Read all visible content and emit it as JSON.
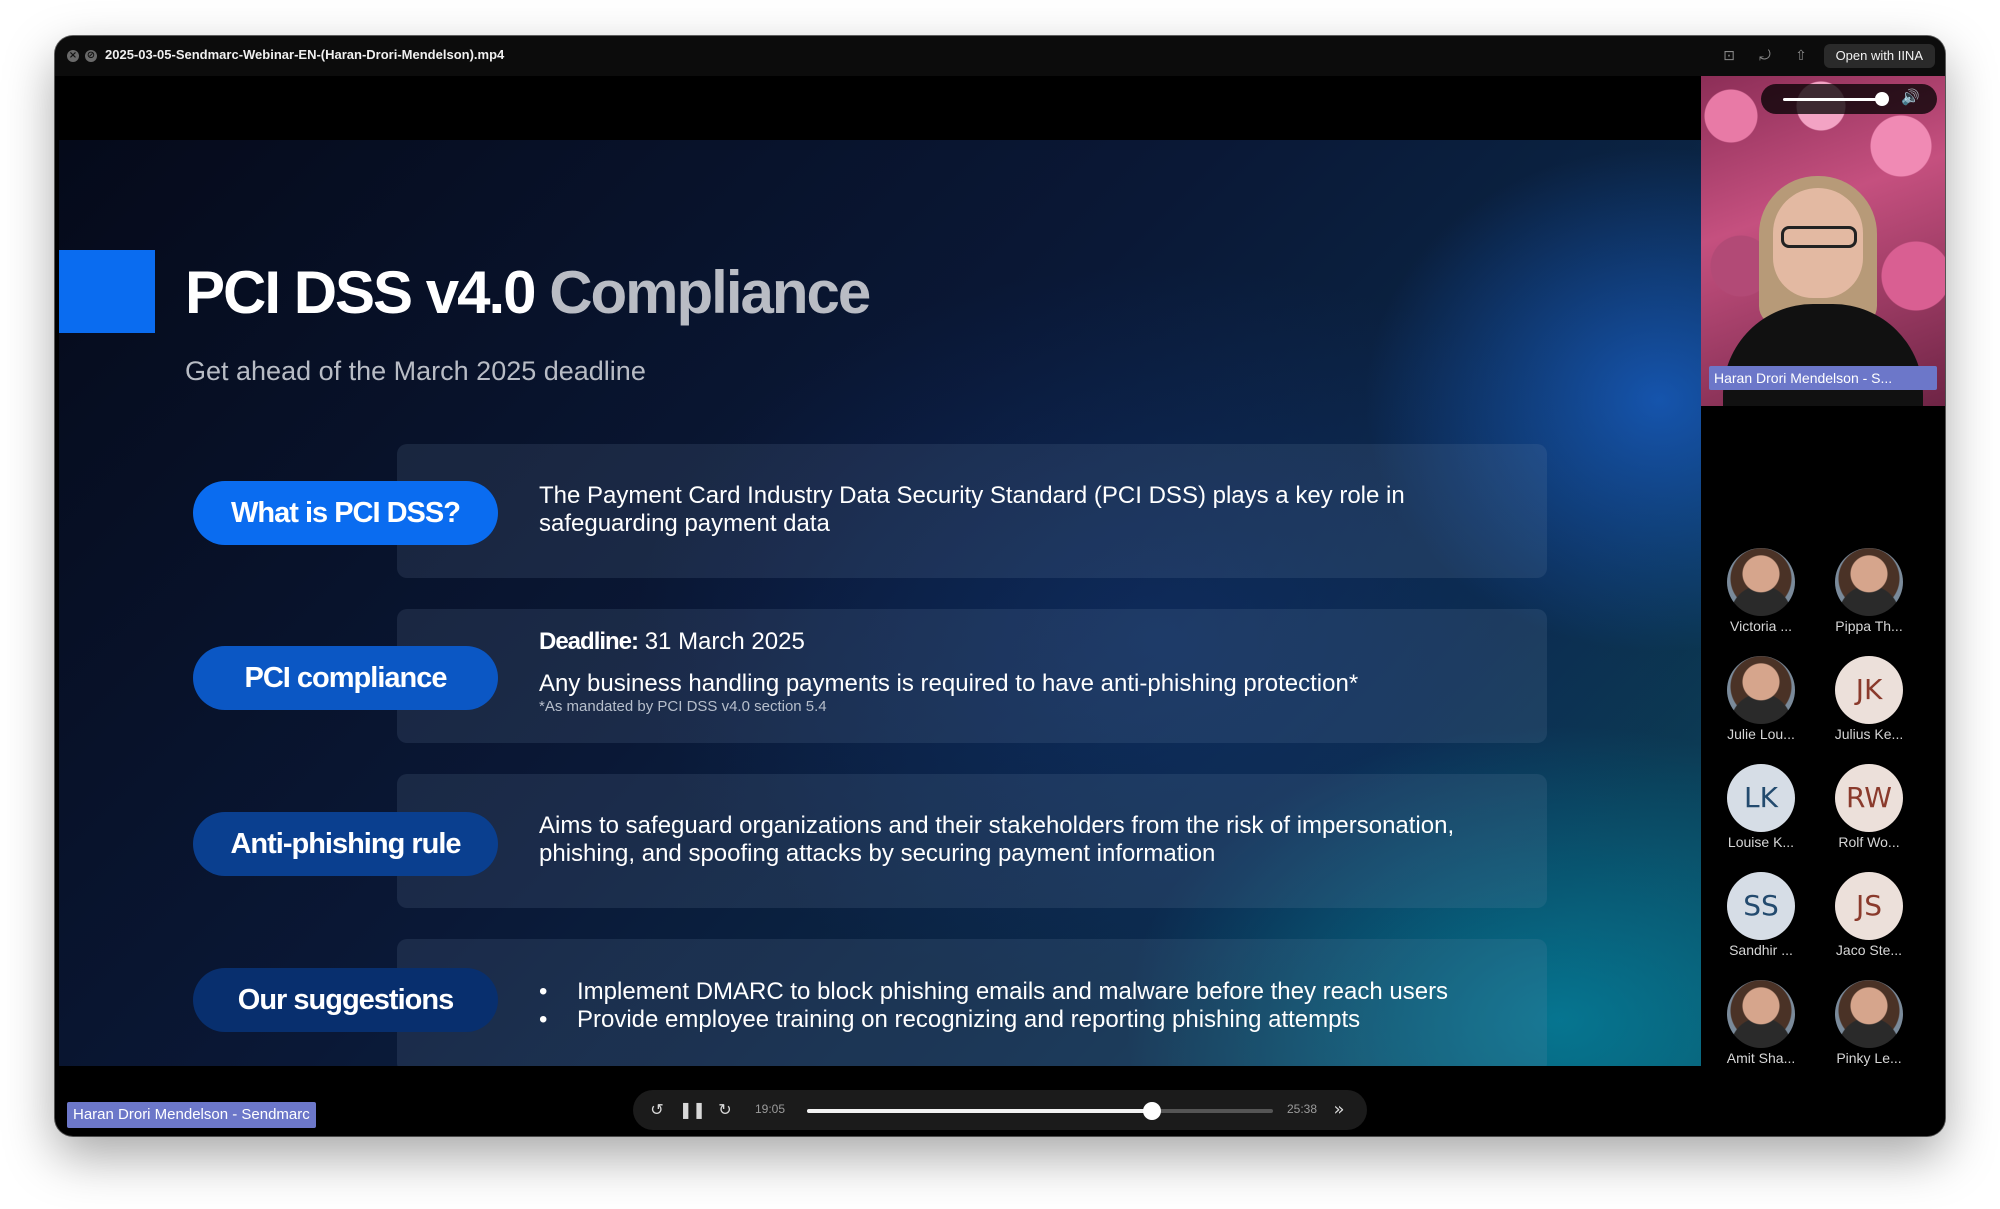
{
  "window": {
    "title": "2025-03-05-Sendmarc-Webinar-EN-(Haran-Drori-Mendelson).mp4",
    "open_with": "Open with IINA"
  },
  "slide": {
    "title_main": "PCI DSS v4.0",
    "title_accent": "Compliance",
    "subtitle": "Get ahead of the March 2025 deadline",
    "rows": [
      {
        "pill": "What is PCI DSS?",
        "pill_color": "#0a6cf0",
        "text": "The Payment Card Industry Data Security Standard (PCI DSS) plays a key role in safeguarding payment data"
      },
      {
        "pill": "PCI compliance",
        "pill_color": "#0b57c4",
        "deadline_label": "Deadline:",
        "deadline_value": " 31 March 2025",
        "text": "Any business handling payments is required to have anti-phishing protection*",
        "footnote": "*As mandated by PCI DSS v4.0 section 5.4"
      },
      {
        "pill": "Anti-phishing rule",
        "pill_color": "#0a3f8f",
        "text": "Aims to safeguard organizations and their stakeholders from the risk of impersonation, phishing, and spoofing attacks by securing payment information"
      },
      {
        "pill": "Our suggestions",
        "pill_color": "#082f6e",
        "bullets": [
          "Implement DMARC to block phishing emails and malware before they reach users",
          "Provide employee training on recognizing and reporting phishing attempts"
        ]
      }
    ]
  },
  "speaker_tag": "Haran Drori Mendelson - Sendmarc",
  "player": {
    "current_time": "19:05",
    "total_time": "25:38",
    "progress_fraction": 0.74,
    "skip_back_icon": "rewind-15-icon",
    "pause_icon": "pause-icon",
    "skip_forward_icon": "forward-15-icon",
    "speed_icon": "fast-forward-icon"
  },
  "side_panel": {
    "camera_name": "Haran Drori Mendelson - S...",
    "volume_fraction": 0.9,
    "participants": [
      {
        "name": "Victoria ...",
        "type": "photo"
      },
      {
        "name": "Pippa Th...",
        "type": "photo"
      },
      {
        "name": "Julie Lou...",
        "type": "photo"
      },
      {
        "name": "Julius Ke...",
        "type": "initials",
        "initials": "JK"
      },
      {
        "name": "Louise K...",
        "type": "initials",
        "initials": "LK"
      },
      {
        "name": "Rolf Wo...",
        "type": "initials",
        "initials": "RW"
      },
      {
        "name": "Sandhir ...",
        "type": "initials",
        "initials": "SS"
      },
      {
        "name": "Jaco Ste...",
        "type": "initials",
        "initials": "JS"
      },
      {
        "name": "Amit Sha...",
        "type": "photo"
      },
      {
        "name": "Pinky Le...",
        "type": "photo"
      }
    ]
  }
}
